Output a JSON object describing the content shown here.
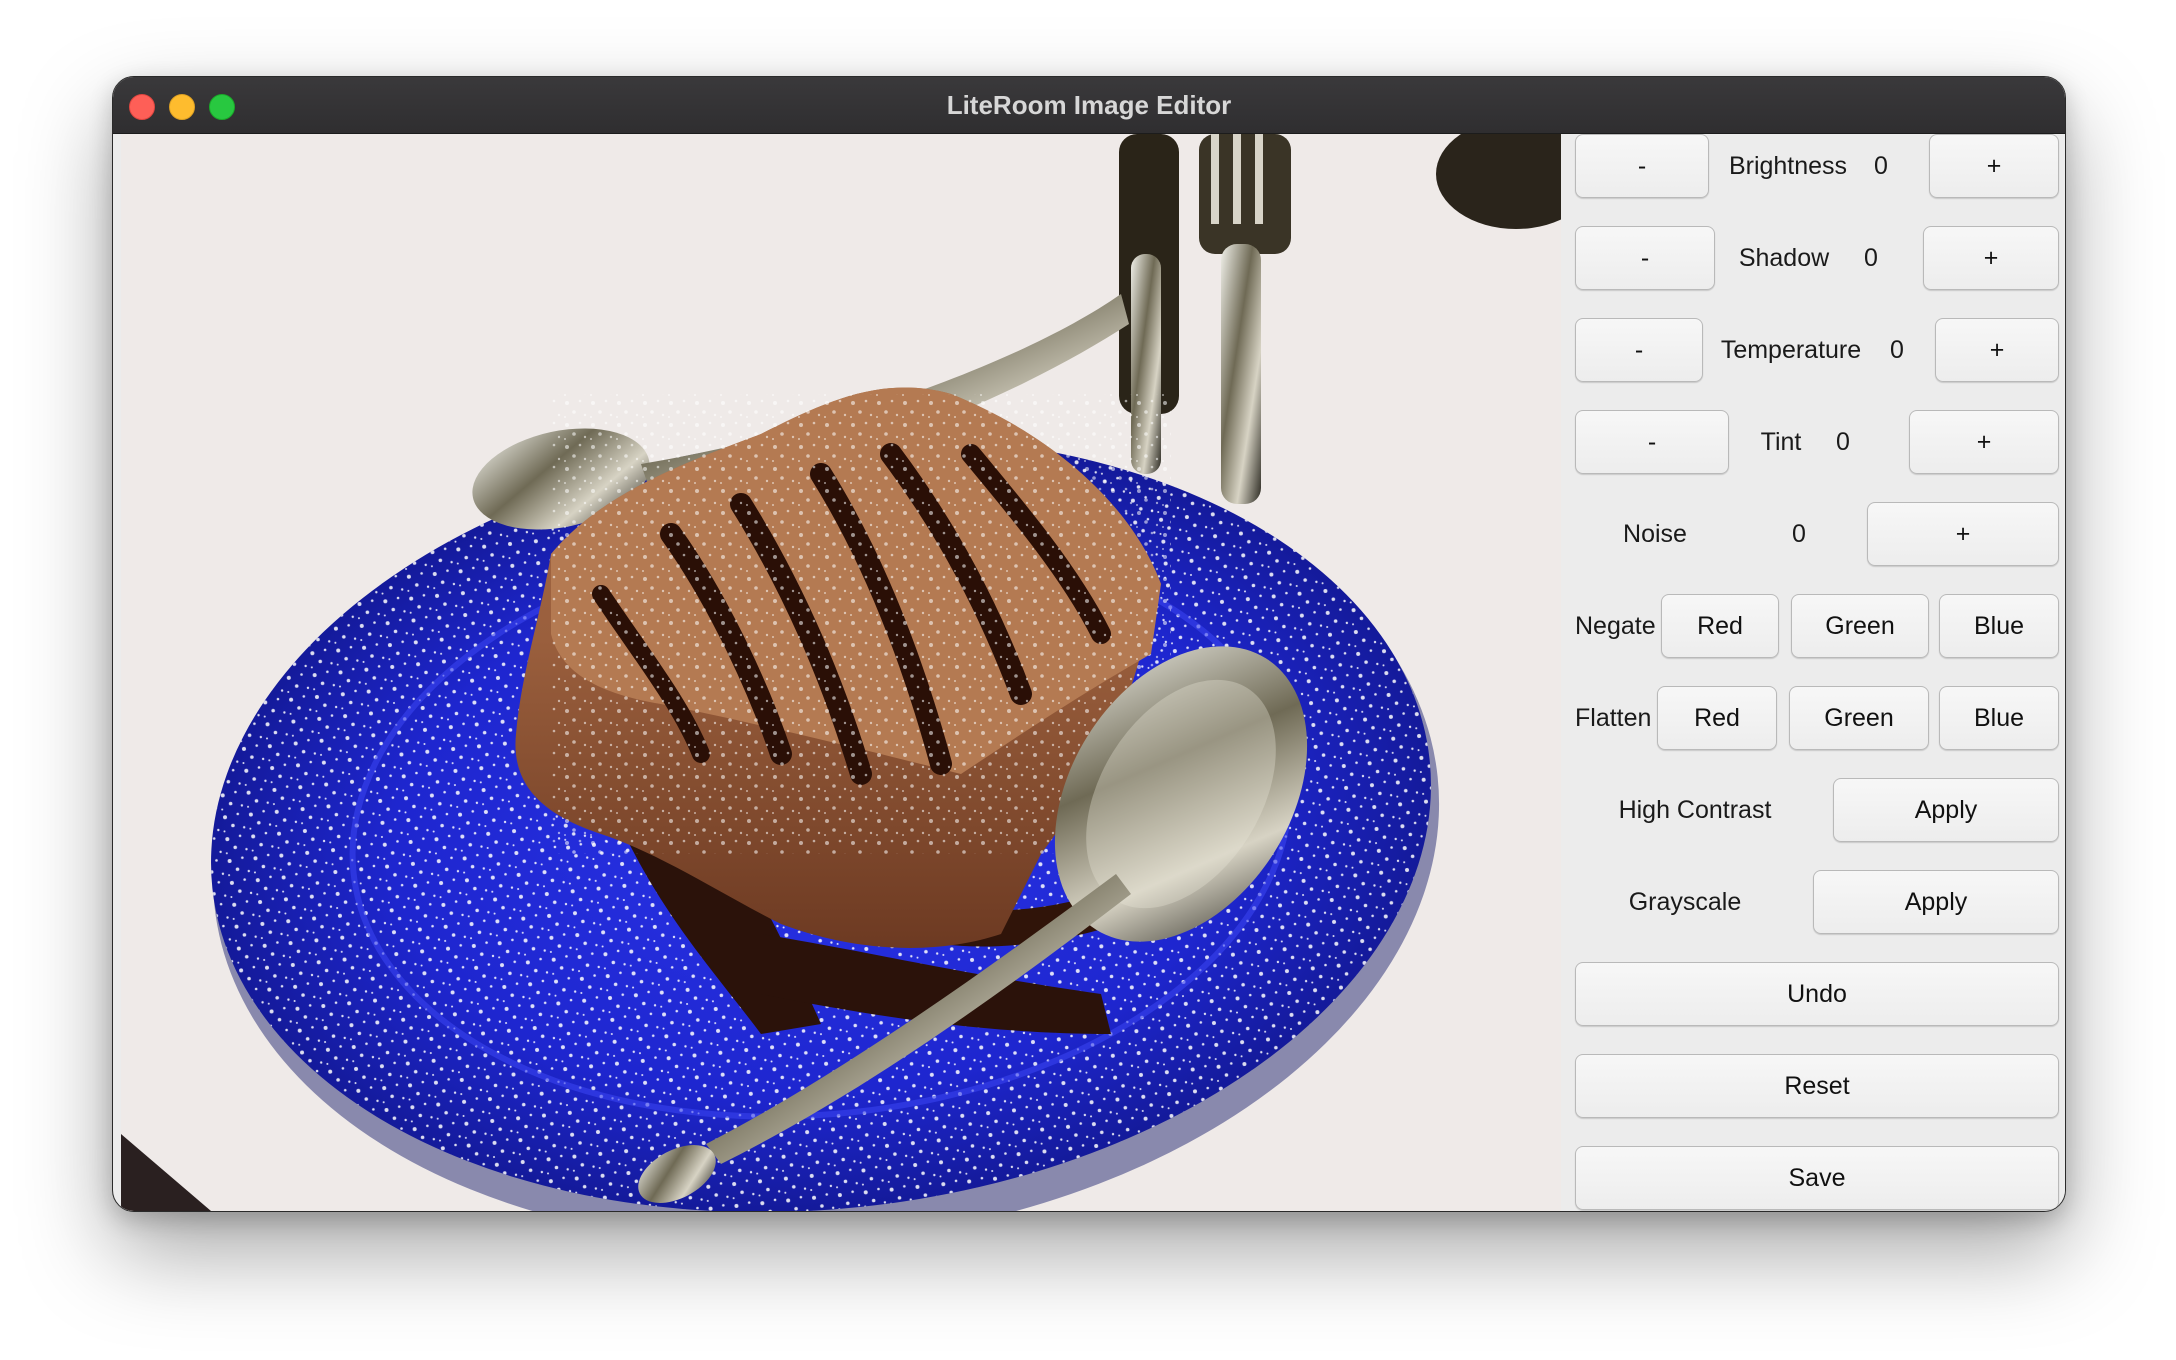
{
  "window": {
    "title": "LiteRoom Image Editor"
  },
  "adjustments": {
    "brightness": {
      "label": "Brightness",
      "value": "0",
      "minus": "-",
      "plus": "+"
    },
    "shadow": {
      "label": "Shadow",
      "value": "0",
      "minus": "-",
      "plus": "+"
    },
    "temperature": {
      "label": "Temperature",
      "value": "0",
      "minus": "-",
      "plus": "+"
    },
    "tint": {
      "label": "Tint",
      "value": "0",
      "minus": "-",
      "plus": "+"
    },
    "noise": {
      "label": "Noise",
      "value": "0",
      "plus": "+"
    }
  },
  "negate": {
    "label": "Negate",
    "red": "Red",
    "green": "Green",
    "blue": "Blue"
  },
  "flatten": {
    "label": "Flatten",
    "red": "Red",
    "green": "Green",
    "blue": "Blue"
  },
  "high_contrast": {
    "label": "High Contrast",
    "button": "Apply"
  },
  "grayscale": {
    "label": "Grayscale",
    "button": "Apply"
  },
  "actions": {
    "undo": "Undo",
    "reset": "Reset",
    "save": "Save"
  },
  "image": {
    "subject": "chocolate cake slice on blue plate with spoons and fork"
  },
  "colors": {
    "plate": "#1f27d6",
    "titlebar": "#323133",
    "panel": "#ececec"
  }
}
